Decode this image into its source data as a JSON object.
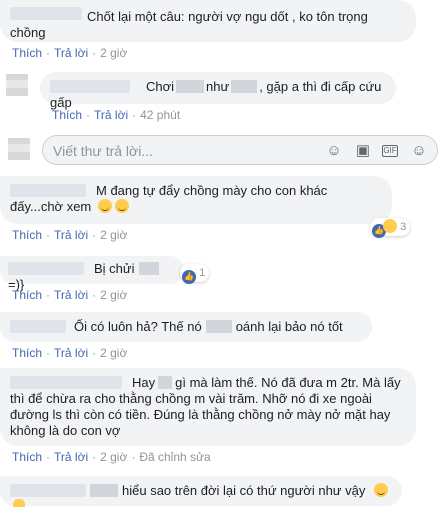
{
  "comments": [
    {
      "text": "Chốt lại một câu: người vợ ngu dốt , ko tôn trọng chồng",
      "actions": {
        "like": "Thích",
        "reply": "Trả lời",
        "time": "2 giờ"
      }
    },
    {
      "text_a": "Chơi",
      "text_b": "như",
      "text_c": ", gặp a thì đi cấp cứu gấp",
      "actions": {
        "like": "Thích",
        "reply": "Trả lời",
        "time": "42 phút"
      }
    },
    {
      "text": "M đang tự đẩy chồng mày cho con khác đấy...chờ xem",
      "reactions": "3",
      "actions": {
        "like": "Thích",
        "reply": "Trả lời",
        "time": "2 giờ"
      }
    },
    {
      "text_a": "Bị chửi",
      "text_b": "=)}",
      "reactions": "1",
      "actions": {
        "like": "Thích",
        "reply": "Trả lời",
        "time": "2 giờ"
      }
    },
    {
      "text_a": "Ối có luôn hả? Thế nó",
      "text_b": "oánh lại bảo nó tốt",
      "actions": {
        "like": "Thích",
        "reply": "Trả lời",
        "time": "2 giờ"
      }
    },
    {
      "text_a": "Hay",
      "text_b": "gì mà làm thế. Nó đã đưa m 2tr. Mà lấy thì để chừa ra cho thằng chồng m vài trăm. Nhỡ nó đi xe ngoài đường ls thì còn có tiền. Đúng là thằng chồng nở mày nở mặt hay không là do con vợ",
      "actions": {
        "like": "Thích",
        "reply": "Trả lời",
        "time": "2 giờ",
        "edited": "Đã chỉnh sửa"
      }
    },
    {
      "text": "hiểu sao trên đời lại có thứ người như vậy"
    }
  ],
  "reply_box": {
    "placeholder": "Viết thư trả lời..."
  },
  "icons": [
    "smiley-icon",
    "camera-icon",
    "gif-icon",
    "sticker-icon"
  ],
  "colors": {
    "link": "#4267b2",
    "meta": "#90949c",
    "bubble": "#f2f3f5"
  }
}
